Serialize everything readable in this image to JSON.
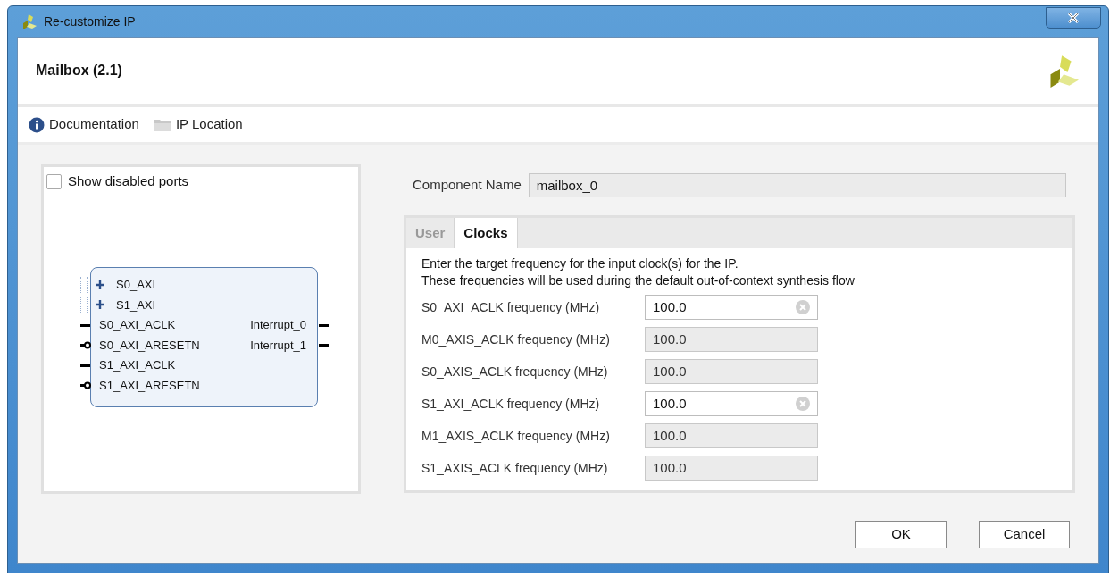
{
  "window": {
    "title": "Re-customize IP"
  },
  "header": {
    "title": "Mailbox (2.1)"
  },
  "toolbar": [
    {
      "kind": "info",
      "label": "Documentation"
    },
    {
      "kind": "folder",
      "label": "IP Location"
    }
  ],
  "left_panel": {
    "show_disabled_ports": {
      "label": "Show disabled ports",
      "checked": false
    },
    "block": {
      "left_ports": [
        {
          "kind": "bus",
          "name": "S0_AXI"
        },
        {
          "kind": "bus",
          "name": "S1_AXI"
        },
        {
          "kind": "clock",
          "name": "S0_AXI_ACLK"
        },
        {
          "kind": "reset",
          "name": "S0_AXI_ARESETN"
        },
        {
          "kind": "clock",
          "name": "S1_AXI_ACLK"
        },
        {
          "kind": "reset",
          "name": "S1_AXI_ARESETN"
        }
      ],
      "right_ports": [
        {
          "name": "Interrupt_0"
        },
        {
          "name": "Interrupt_1"
        }
      ]
    }
  },
  "component_name": {
    "label": "Component Name",
    "value": "mailbox_0"
  },
  "tabs": [
    {
      "label": "User",
      "selected": false
    },
    {
      "label": "Clocks",
      "selected": true
    }
  ],
  "clocks": {
    "description": [
      "Enter the target frequency for the input clock(s) for the IP.",
      "These frequencies will be used during the default out-of-context synthesis flow"
    ],
    "fields": [
      {
        "label": "S0_AXI_ACLK frequency (MHz)",
        "value": "100.0",
        "disabled": false
      },
      {
        "label": "M0_AXIS_ACLK frequency (MHz)",
        "value": "100.0",
        "disabled": true
      },
      {
        "label": "S0_AXIS_ACLK frequency (MHz)",
        "value": "100.0",
        "disabled": true
      },
      {
        "label": "S1_AXI_ACLK frequency (MHz)",
        "value": "100.0",
        "disabled": false
      },
      {
        "label": "M1_AXIS_ACLK frequency (MHz)",
        "value": "100.0",
        "disabled": true
      },
      {
        "label": "S1_AXIS_ACLK frequency (MHz)",
        "value": "100.0",
        "disabled": true
      }
    ]
  },
  "buttons": [
    "OK",
    "Cancel"
  ]
}
